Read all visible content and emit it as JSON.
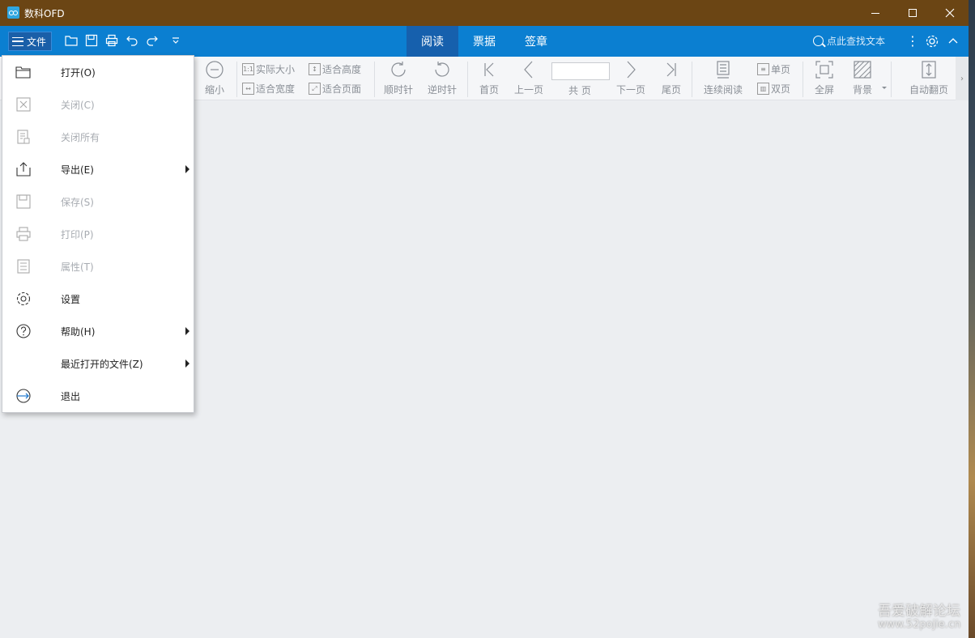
{
  "window": {
    "title": "数科OFD"
  },
  "menubar": {
    "file_label": "文件",
    "tabs": [
      {
        "label": "阅读",
        "active": true
      },
      {
        "label": "票据",
        "active": false
      },
      {
        "label": "签章",
        "active": false
      }
    ],
    "search_placeholder": "点此查找文本"
  },
  "ribbon": {
    "zoom_out": "缩小",
    "actual_size": "实际大小",
    "fit_width": "适合宽度",
    "fit_height": "适合高度",
    "fit_page": "适合页面",
    "rotate_cw": "顺时针",
    "rotate_ccw": "逆时针",
    "first_page": "首页",
    "prev_page": "上一页",
    "page_total": "共 页",
    "next_page": "下一页",
    "last_page": "尾页",
    "continuous": "连续阅读",
    "single_page": "单页",
    "double_page": "双页",
    "fullscreen": "全屏",
    "background": "背景",
    "auto_flip": "自动翻页"
  },
  "file_menu": {
    "items": [
      {
        "label": "打开(O)",
        "disabled": false
      },
      {
        "label": "关闭(C)",
        "disabled": true
      },
      {
        "label": "关闭所有",
        "disabled": true
      },
      {
        "label": "导出(E)",
        "disabled": false
      },
      {
        "label": "保存(S)",
        "disabled": true
      },
      {
        "label": "打印(P)",
        "disabled": true
      },
      {
        "label": "属性(T)",
        "disabled": true
      },
      {
        "label": "设置",
        "disabled": false
      },
      {
        "label": "帮助(H)",
        "disabled": false
      },
      {
        "label": "最近打开的文件(Z)",
        "disabled": false
      },
      {
        "label": "退出",
        "disabled": false
      }
    ]
  },
  "watermark": {
    "line1": "吾爱破解论坛",
    "line2": "www.52pojie.cn"
  },
  "colors": {
    "titlebar": "#6b4514",
    "menubar": "#0b7fd1",
    "active_tab": "#1660ad"
  }
}
